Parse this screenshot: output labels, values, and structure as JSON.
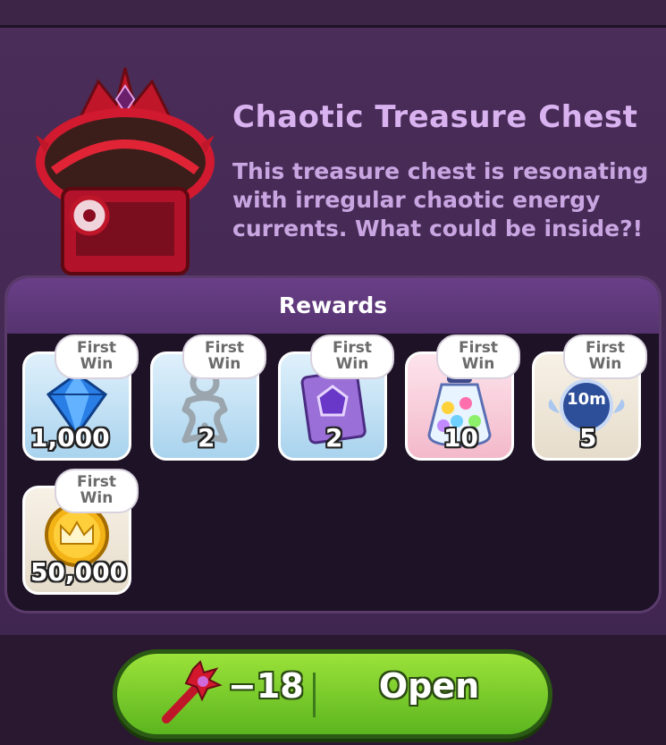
{
  "chest": {
    "title": "Chaotic Treasure Chest",
    "description": "This treasure chest is resonating with irregular chaotic energy currents. What could be inside?!"
  },
  "rewards": {
    "header": "Rewards",
    "badge_line1": "First",
    "badge_line2": "Win",
    "items": [
      {
        "icon": "crystal-gem-icon",
        "quantity": "1,000"
      },
      {
        "icon": "gingerbread-cutter-icon",
        "quantity": "2"
      },
      {
        "icon": "purple-gem-book-icon",
        "quantity": "2"
      },
      {
        "icon": "rainbow-star-jar-icon",
        "quantity": "10"
      },
      {
        "icon": "speedup-10m-icon",
        "quantity": "5",
        "timer_label": "10m"
      },
      {
        "icon": "gold-crown-coin-icon",
        "quantity": "50,000"
      }
    ]
  },
  "action": {
    "cost": "−18",
    "button_label": "Open",
    "cost_icon": "chaos-key-icon"
  },
  "colors": {
    "panel": "#4a2d58",
    "title": "#d9b2f0",
    "button_green": "#7ccc2c"
  }
}
